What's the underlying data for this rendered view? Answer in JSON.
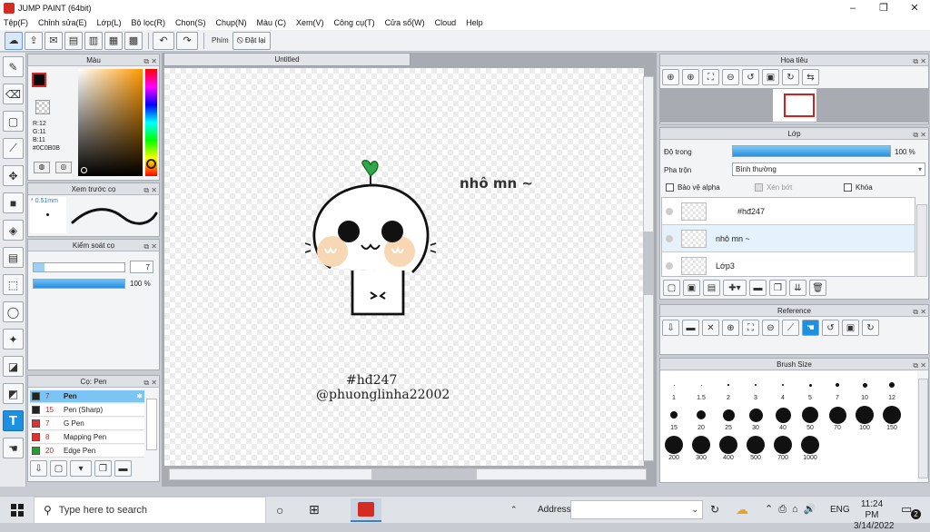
{
  "window": {
    "title": "JUMP PAINT (64bit)"
  },
  "menu": [
    "Tệp(F)",
    "Chỉnh sửa(E)",
    "Lớp(L)",
    "Bộ lọc(R)",
    "Chọn(S)",
    "Chụp(N)",
    "Màu (C)",
    "Xem(V)",
    "Công cụ(T)",
    "Cửa sổ(W)",
    "Cloud",
    "Help"
  ],
  "toolbar": {
    "key_label": "Phím",
    "reset_label": "Đặt lại"
  },
  "color_panel": {
    "title": "Màu",
    "r": "R:12",
    "g": "G:11",
    "b": "B:11",
    "hex": "#0C0B0B"
  },
  "preview_panel": {
    "title": "Xem trước cọ",
    "size": "0.51mm"
  },
  "brush_control": {
    "title": "Kiểm soát cọ",
    "size_value": "7",
    "opacity_value": "100 %",
    "opacity_fraction": 1.0
  },
  "brush_list": {
    "title": "Cọ: Pen",
    "items": [
      {
        "size": "7",
        "name": "Pen",
        "color": "#222222",
        "selected": true
      },
      {
        "size": "15",
        "name": "Pen (Sharp)",
        "color": "#222222",
        "selected": false
      },
      {
        "size": "7",
        "name": "G Pen",
        "color": "#e03030",
        "selected": false
      },
      {
        "size": "8",
        "name": "Mapping Pen",
        "color": "#e03030",
        "selected": false
      },
      {
        "size": "20",
        "name": "Edge Pen",
        "color": "#22a02a",
        "selected": false
      }
    ]
  },
  "document": {
    "tab": "Untitled",
    "text_greeting": "nhô mn ~",
    "text_hashtag": "#hđ247",
    "text_handle": "@phuonglinha22002"
  },
  "navigator": {
    "title": "Hoa tiêu"
  },
  "layer_panel": {
    "title": "Lớp",
    "opacity_label": "Độ trong",
    "opacity_value": "100 %",
    "opacity_fraction": 1.0,
    "blend_label": "Pha trộn",
    "blend_value": "Bình thường",
    "protect_alpha": "Bảo vệ alpha",
    "clip": "Xén bớt",
    "lock": "Khóa",
    "layers": [
      {
        "name": "#hđ247"
      },
      {
        "name": "nhô mn ~"
      },
      {
        "name": "Lớp3"
      }
    ]
  },
  "reference": {
    "title": "Reference"
  },
  "brush_size": {
    "title": "Brush Size",
    "sizes": [
      "1",
      "1.5",
      "2",
      "3",
      "4",
      "5",
      "7",
      "10",
      "12",
      "15",
      "20",
      "25",
      "30",
      "40",
      "50",
      "70",
      "100",
      "150",
      "200",
      "300",
      "400",
      "500",
      "700",
      "1000"
    ]
  },
  "taskbar": {
    "search_placeholder": "Type here to search",
    "address_label": "Address",
    "lang": "ENG",
    "time": "11:24 PM",
    "date": "3/14/2022",
    "notif_count": "2"
  }
}
